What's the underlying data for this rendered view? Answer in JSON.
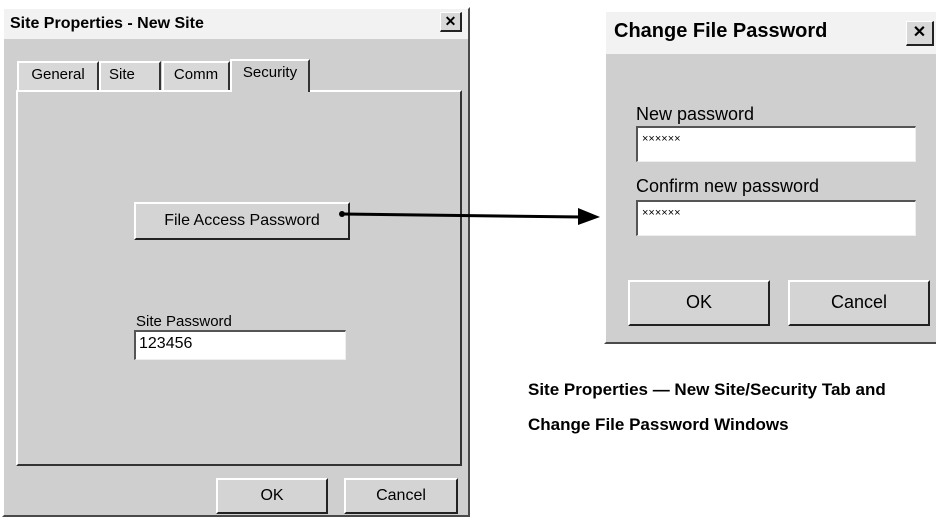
{
  "site_properties": {
    "title": "Site Properties - New Site",
    "close_glyph": "✕",
    "tabs": [
      {
        "label": "General"
      },
      {
        "label": "Site"
      },
      {
        "label": "Comm"
      },
      {
        "label": "Security"
      }
    ],
    "active_tab": "Security",
    "file_access_button": "File Access Password",
    "site_password_label": "Site Password",
    "site_password_value": "123456",
    "ok_label": "OK",
    "cancel_label": "Cancel"
  },
  "change_password": {
    "title": "Change File Password",
    "close_glyph": "✕",
    "new_password_label": "New password",
    "new_password_value": "××××××",
    "confirm_password_label": "Confirm new password",
    "confirm_password_value": "××××××",
    "ok_label": "OK",
    "cancel_label": "Cancel"
  },
  "caption": {
    "line1": "Site Properties — New Site/Security Tab and",
    "line2": "Change File Password Windows"
  }
}
